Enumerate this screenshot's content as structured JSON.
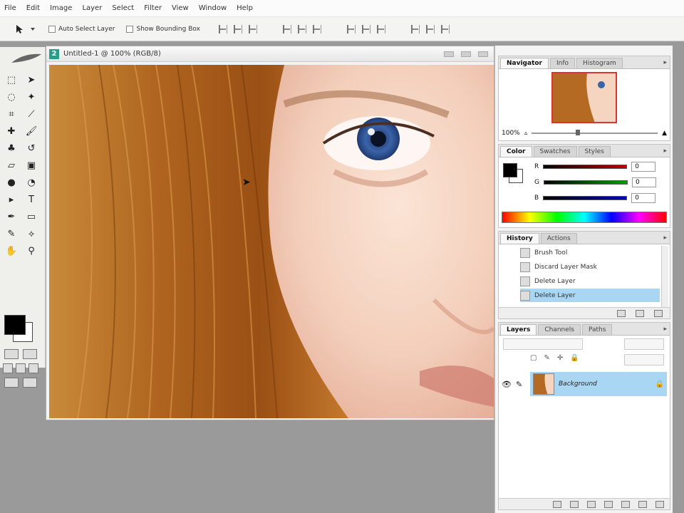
{
  "menu": [
    "File",
    "Edit",
    "Image",
    "Layer",
    "Select",
    "Filter",
    "View",
    "Window",
    "Help"
  ],
  "options": {
    "auto_select_label": "Auto Select Layer",
    "bounding_box_label": "Show Bounding Box"
  },
  "document": {
    "title": "Untitled-1 @ 100% (RGB/8)",
    "logo": "2"
  },
  "navigator": {
    "tabs": [
      "Navigator",
      "Info",
      "Histogram"
    ],
    "zoom": "100%",
    "zoom_level": 0.35
  },
  "color": {
    "tabs": [
      "Color",
      "Swatches",
      "Styles"
    ],
    "channels": [
      {
        "label": "R",
        "value": "0",
        "color": "#c00000"
      },
      {
        "label": "G",
        "value": "0",
        "color": "#00a000"
      },
      {
        "label": "B",
        "value": "0",
        "color": "#0000c0"
      }
    ]
  },
  "history": {
    "tabs": [
      "History",
      "Actions"
    ],
    "items": [
      "Brush Tool",
      "Discard Layer Mask",
      "Delete Layer",
      "Delete Layer"
    ],
    "selected_index": 3
  },
  "layers": {
    "tabs": [
      "Layers",
      "Channels",
      "Paths"
    ],
    "layer_name": "Background"
  },
  "colors": {
    "selection": "#a9d6f2",
    "foreground": "#000000",
    "background": "#ffffff"
  },
  "tools": [
    "marquee-icon",
    "move-icon",
    "lasso-icon",
    "magic-wand-icon",
    "crop-icon",
    "slice-icon",
    "healing-brush-icon",
    "brush-icon",
    "clone-stamp-icon",
    "history-brush-icon",
    "eraser-icon",
    "gradient-icon",
    "blur-icon",
    "dodge-icon",
    "path-select-icon",
    "type-icon",
    "pen-icon",
    "shape-icon",
    "notes-icon",
    "eyedropper-icon",
    "hand-icon",
    "zoom-icon"
  ]
}
